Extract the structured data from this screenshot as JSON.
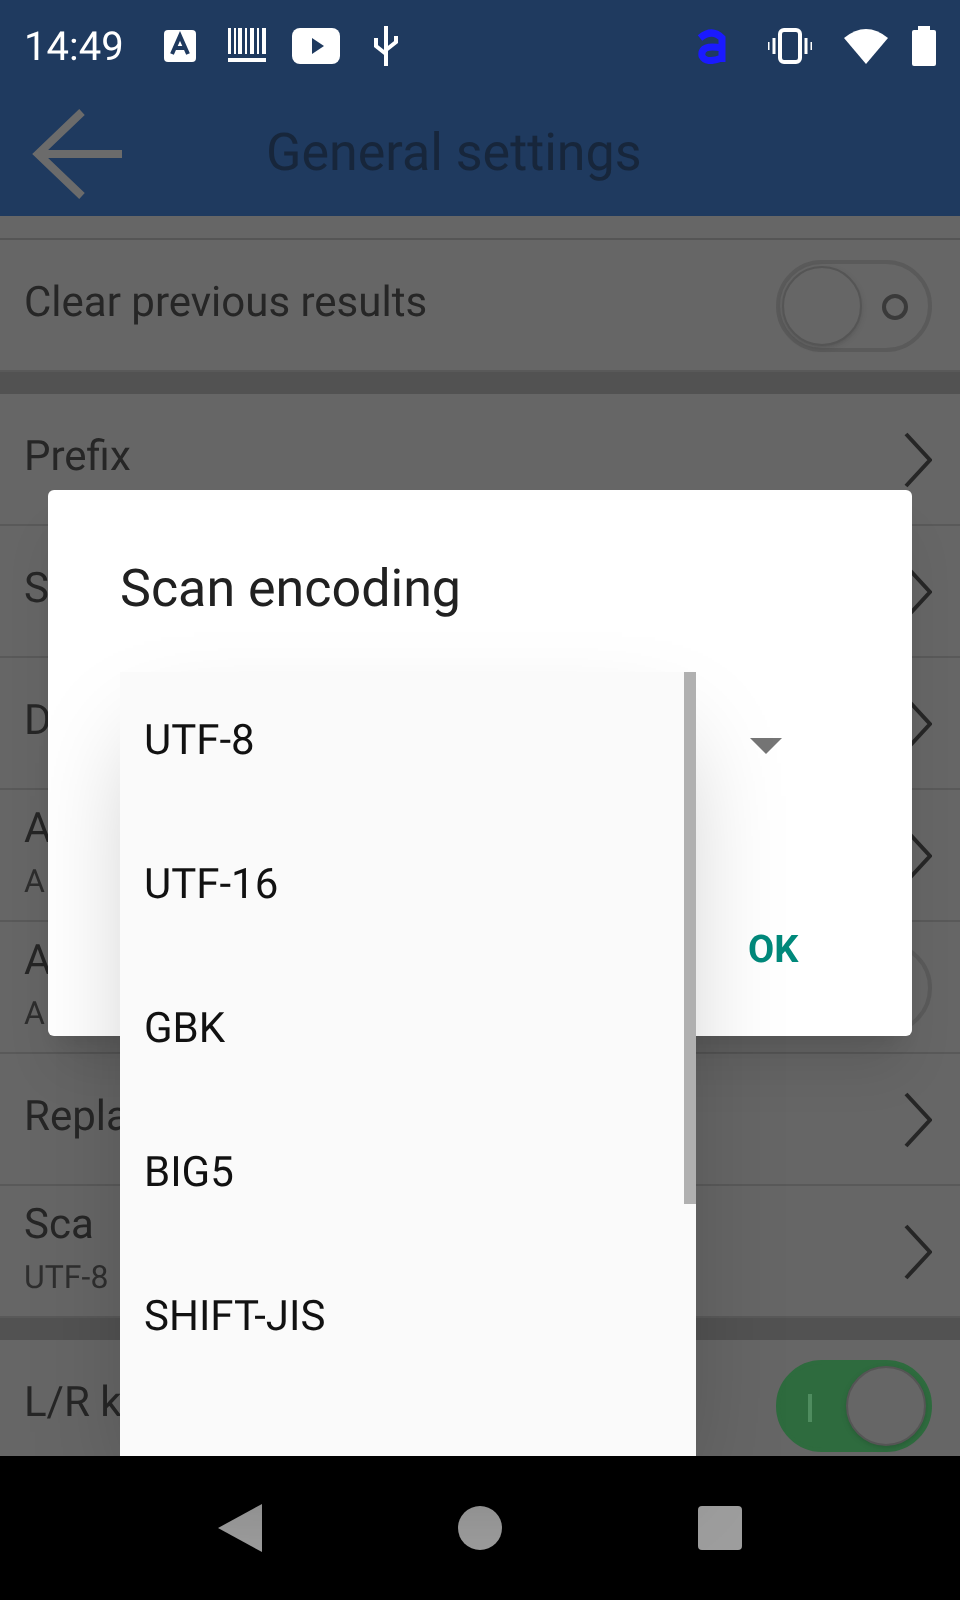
{
  "status_bar": {
    "time": "14:49"
  },
  "app_bar": {
    "title": "General settings"
  },
  "settings": [
    {
      "kind": "toggle",
      "label": "Clear previous results",
      "on": false
    },
    {
      "kind": "divider"
    },
    {
      "kind": "link",
      "label": "Prefix"
    },
    {
      "kind": "link",
      "label": "S"
    },
    {
      "kind": "link",
      "label": "D"
    },
    {
      "kind": "link",
      "label": "A",
      "subtitle": "A"
    },
    {
      "kind": "toggle",
      "label": "A",
      "subtitle": "A",
      "on": false
    },
    {
      "kind": "link",
      "label": "Repla"
    },
    {
      "kind": "link",
      "label": "Sca",
      "subtitle": "UTF-8"
    },
    {
      "kind": "divider"
    },
    {
      "kind": "toggle",
      "label": "L/R k",
      "on": true
    }
  ],
  "dialog": {
    "title": "Scan encoding",
    "ok": "OK",
    "options": [
      "UTF-8",
      "UTF-16",
      "GBK",
      "BIG5",
      "SHIFT-JIS"
    ]
  }
}
